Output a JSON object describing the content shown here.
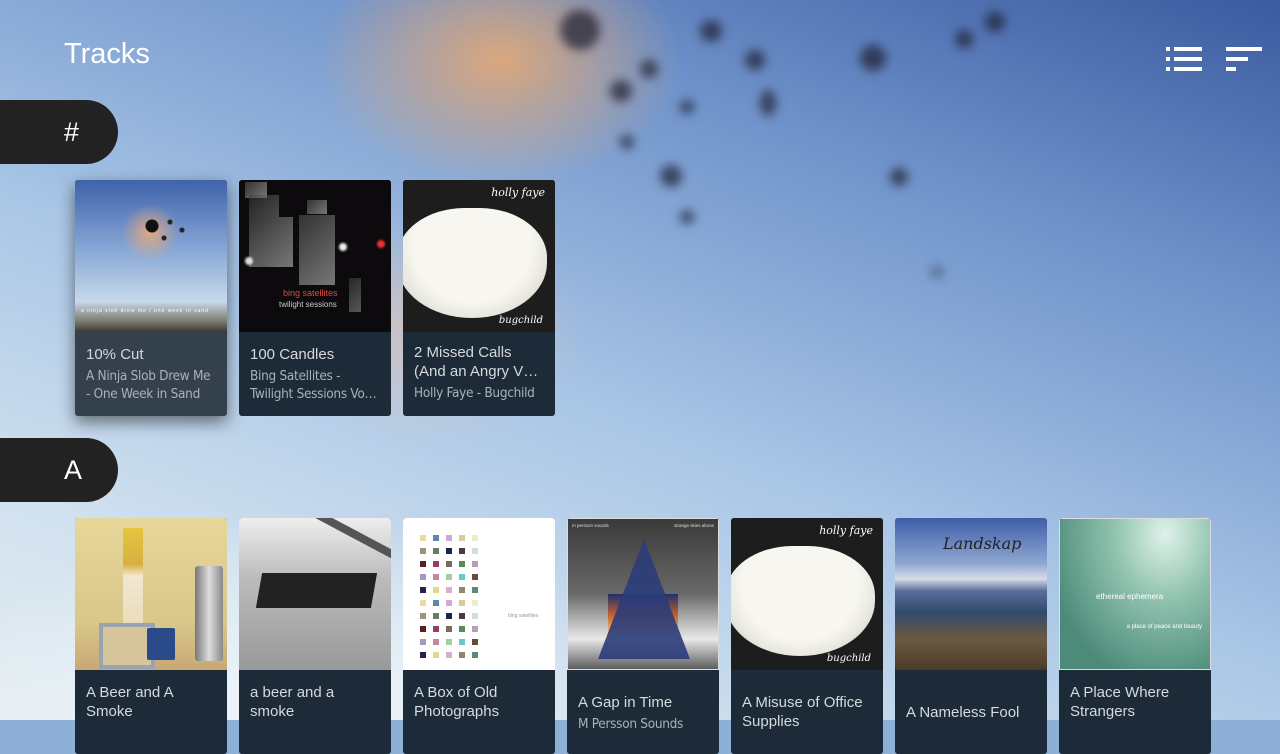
{
  "header": {
    "title": "Tracks"
  },
  "toolbar": {
    "view_mode_icon": "list-icon",
    "sort_icon": "sort-icon"
  },
  "sections": [
    {
      "letter": "#",
      "items": [
        {
          "title": "10% Cut",
          "subtitle": "A Ninja Slob Drew Me - One Week in Sand",
          "art": "sky-birds",
          "focused": true
        },
        {
          "title": "100 Candles",
          "subtitle": "Bing Satellites - Twilight Sessions Vo…",
          "art": "dark-blocks",
          "focused": false
        },
        {
          "title": "2 Missed Calls (And an Angry V…",
          "subtitle": "Holly Faye - Bugchild",
          "art": "rice-bowl",
          "focused": false
        }
      ]
    },
    {
      "letter": "A",
      "items": [
        {
          "title": "A Beer and A Smoke",
          "subtitle": "",
          "art": "toys-shelf"
        },
        {
          "title": "a beer and a smoke",
          "subtitle": "",
          "art": "bw-piano"
        },
        {
          "title": "A Box of Old Photographs",
          "subtitle": "",
          "art": "color-grid"
        },
        {
          "title": "A Gap in Time",
          "subtitle": "M Persson Sounds",
          "art": "storm-star"
        },
        {
          "title": "A Misuse of Office Supplies",
          "subtitle": "",
          "art": "rice-bowl"
        },
        {
          "title": "A Nameless Fool",
          "subtitle": "",
          "art": "landskap"
        },
        {
          "title": "A Place Where Strangers Gather…",
          "subtitle": "",
          "art": "ethereal"
        }
      ]
    }
  ],
  "art_text": {
    "sky_caption": "a ninja slob drew me / one week in sand",
    "dark_artist": "bing satellites",
    "dark_album": "twilight sessions",
    "rice_artist": "holly faye",
    "rice_album": "bugchild",
    "grid_label": "bing satellites",
    "storm_left": "m persson sounds",
    "storm_right": "strange skies above",
    "landskap": "Landskap",
    "ether_title": "ethereal ephemera",
    "ether_sub": "a place of peace and beauty"
  }
}
